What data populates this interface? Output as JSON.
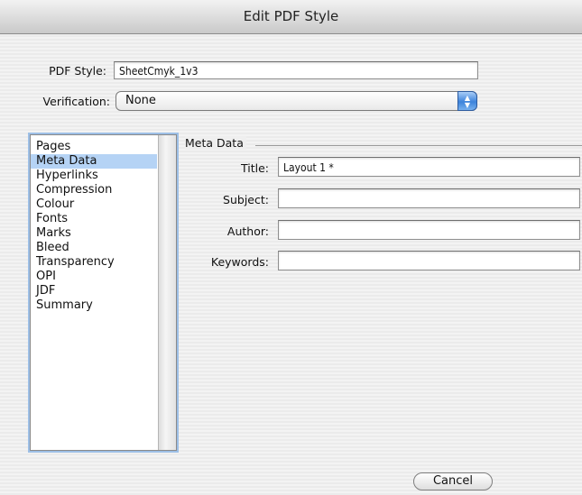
{
  "window": {
    "title": "Edit PDF Style"
  },
  "form": {
    "pdf_style_label": "PDF Style:",
    "pdf_style_value": "SheetCmyk_1v3",
    "verification_label": "Verification:",
    "verification_value": "None"
  },
  "sidebar": {
    "items": [
      {
        "label": "Pages",
        "selected": false
      },
      {
        "label": "Meta Data",
        "selected": true
      },
      {
        "label": "Hyperlinks",
        "selected": false
      },
      {
        "label": "Compression",
        "selected": false
      },
      {
        "label": "Colour",
        "selected": false
      },
      {
        "label": "Fonts",
        "selected": false
      },
      {
        "label": "Marks",
        "selected": false
      },
      {
        "label": "Bleed",
        "selected": false
      },
      {
        "label": "Transparency",
        "selected": false
      },
      {
        "label": "OPI",
        "selected": false
      },
      {
        "label": "JDF",
        "selected": false
      },
      {
        "label": "Summary",
        "selected": false
      }
    ]
  },
  "meta_data": {
    "group_title": "Meta Data",
    "title_label": "Title:",
    "title_value": "Layout 1 *",
    "subject_label": "Subject:",
    "subject_value": "",
    "author_label": "Author:",
    "author_value": "",
    "keywords_label": "Keywords:",
    "keywords_value": ""
  },
  "buttons": {
    "cancel_label": "Cancel"
  },
  "colors": {
    "selection": "#b5d3f5",
    "accent": "#3d83db"
  }
}
